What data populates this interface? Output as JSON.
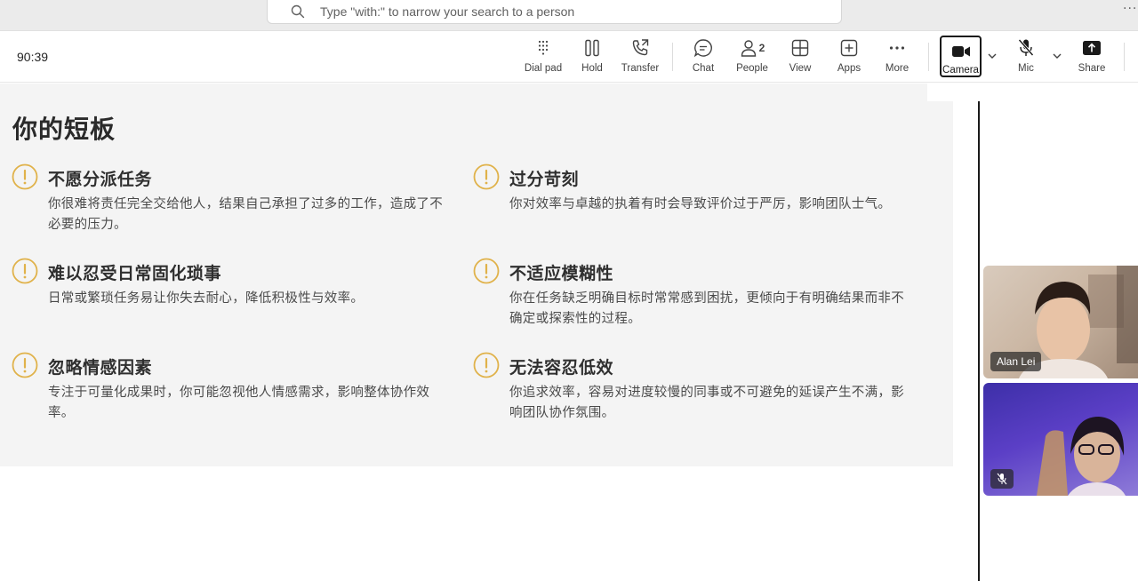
{
  "search": {
    "placeholder": "Type \"with:\" to narrow your search to a person"
  },
  "top_more": "···",
  "call": {
    "timer": "90:39"
  },
  "toolbar": {
    "dial_pad": "Dial pad",
    "hold": "Hold",
    "transfer": "Transfer",
    "chat": "Chat",
    "people": "People",
    "people_count": "2",
    "view": "View",
    "apps": "Apps",
    "more": "More",
    "camera": "Camera",
    "mic": "Mic",
    "share": "Share"
  },
  "slide": {
    "title": "你的短板",
    "items": [
      {
        "title": "不愿分派任务",
        "desc": "你很难将责任完全交给他人，结果自己承担了过多的工作，造成了不必要的压力。"
      },
      {
        "title": "过分苛刻",
        "desc": "你对效率与卓越的执着有时会导致评价过于严厉，影响团队士气。"
      },
      {
        "title": "难以忍受日常固化琐事",
        "desc": "日常或繁琐任务易让你失去耐心，降低积极性与效率。"
      },
      {
        "title": "不适应模糊性",
        "desc": "你在任务缺乏明确目标时常常感到困扰，更倾向于有明确结果而非不确定或探索性的过程。"
      },
      {
        "title": "忽略情感因素",
        "desc": "专注于可量化成果时，你可能忽视他人情感需求，影响整体协作效率。"
      },
      {
        "title": "无法容忍低效",
        "desc": "你追求效率，容易对进度较慢的同事或不可避免的延误产生不满，影响团队协作氛围。"
      }
    ]
  },
  "participants": [
    {
      "name": "Alan Lei"
    }
  ],
  "colors": {
    "warning": "#e0b24a",
    "slide_bg": "#f4f4f4",
    "toolbar_text": "#424242"
  },
  "icons": [
    "search-icon",
    "dial-pad-icon",
    "hold-icon",
    "transfer-icon",
    "chat-icon",
    "people-icon",
    "view-icon",
    "apps-icon",
    "more-icon",
    "camera-icon",
    "mic-off-icon",
    "share-icon",
    "warning-icon"
  ]
}
